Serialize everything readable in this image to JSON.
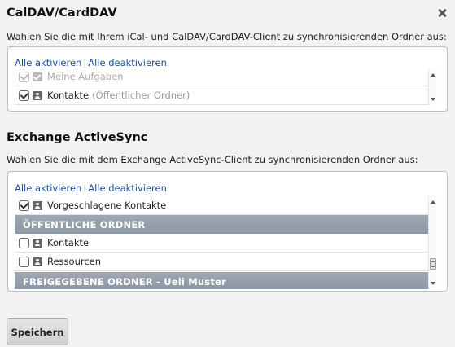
{
  "dialog": {
    "close_label": "✖"
  },
  "caldav": {
    "title": "CalDAV/CardDAV",
    "description": "Wählen Sie die mit Ihrem iCal- und CalDAV/CardDAV-Client zu synchronisierenden Ordner aus:",
    "activate_all": "Alle aktivieren",
    "deactivate_all": "Alle deaktivieren",
    "items": [
      {
        "label": "Meine Aufgaben",
        "suffix": "",
        "checked": true,
        "icon": "tasks-icon",
        "muted": true
      },
      {
        "label": "Kontakte",
        "suffix": "(Öffentlicher Ordner)",
        "checked": true,
        "icon": "contacts-icon",
        "muted": false
      }
    ]
  },
  "activesync": {
    "title": "Exchange ActiveSync",
    "description": "Wählen Sie die mit dem Exchange ActiveSync-Client zu synchronisierenden Ordner aus:",
    "activate_all": "Alle aktivieren",
    "deactivate_all": "Alle deaktivieren",
    "items": [
      {
        "label": "Vorgeschlagene Kontakte",
        "checked": true,
        "icon": "contacts-icon"
      },
      {
        "group": "ÖFFENTLICHE ORDNER"
      },
      {
        "label": "Kontakte",
        "checked": false,
        "icon": "contacts-icon"
      },
      {
        "label": "Ressourcen",
        "checked": false,
        "icon": "contacts-icon"
      },
      {
        "group": "FREIGEGEBENE ORDNER - Ueli Muster"
      }
    ]
  },
  "footer": {
    "save_label": "Speichern"
  }
}
